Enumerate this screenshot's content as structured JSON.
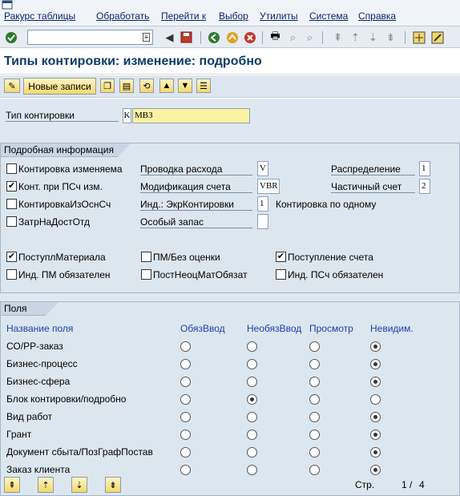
{
  "menu": {
    "items": [
      "Ракурс таблицы",
      "Обработать",
      "Перейти к",
      "Выбор",
      "Утилиты",
      "Система",
      "Справка"
    ]
  },
  "toolbar": {
    "command_value": ""
  },
  "title": "Типы контировки: изменение: подробно",
  "app_toolbar": {
    "new_entries_label": "Новые записи"
  },
  "header_field": {
    "label": "Тип контировки",
    "key": "K",
    "value": "МВЗ"
  },
  "details": {
    "title": "Подробная информация",
    "checkboxes_left": [
      {
        "label": "Контировка изменяема",
        "checked": false
      },
      {
        "label": "Конт. при ПСч изм.",
        "checked": true
      },
      {
        "label": "КонтировкаИзОснСч",
        "checked": false
      },
      {
        "label": "ЗатрНаДостОтд",
        "checked": false
      }
    ],
    "mid_fields": [
      {
        "label": "Проводка расхода",
        "value": "V"
      },
      {
        "label": "Модификация счета",
        "value": "VBR"
      },
      {
        "label": "Инд.: ЭкрКонтировки",
        "value": "1"
      },
      {
        "label": "Особый запас",
        "value": ""
      }
    ],
    "right_fields": [
      {
        "label": "Распределение",
        "value": "1"
      },
      {
        "label": "Частичный счет",
        "value": "2"
      }
    ],
    "single_account_label": "Контировка по одному",
    "checkboxes_bottom": [
      {
        "label": "ПоступлМатериала",
        "checked": true
      },
      {
        "label": "ПМ/Без оценки",
        "checked": false
      },
      {
        "label": "Поступление счета",
        "checked": true
      },
      {
        "label": "Инд. ПМ обязателен",
        "checked": false
      },
      {
        "label": "ПостНеоцМатОбязат",
        "checked": false
      },
      {
        "label": "Инд. ПСч обязателен",
        "checked": false
      }
    ]
  },
  "fields": {
    "title": "Поля",
    "columns": [
      "Название поля",
      "ОбязВвод",
      "НеобязВвод",
      "Просмотр",
      "Невидим."
    ],
    "rows": [
      {
        "name": "СО/PP-заказ",
        "selected": 3
      },
      {
        "name": "Бизнес-процесс",
        "selected": 3
      },
      {
        "name": "Бизнес-сфера",
        "selected": 3
      },
      {
        "name": "Блок контировки/подробно",
        "selected": 1
      },
      {
        "name": "Вид работ",
        "selected": 3
      },
      {
        "name": "Грант",
        "selected": 3
      },
      {
        "name": "Документ сбыта/ПозГрафПостав",
        "selected": 3
      },
      {
        "name": "Заказ клиента",
        "selected": 3
      }
    ]
  },
  "paging": {
    "label": "Стр.",
    "current": "1",
    "separator": "/",
    "total": "4"
  }
}
